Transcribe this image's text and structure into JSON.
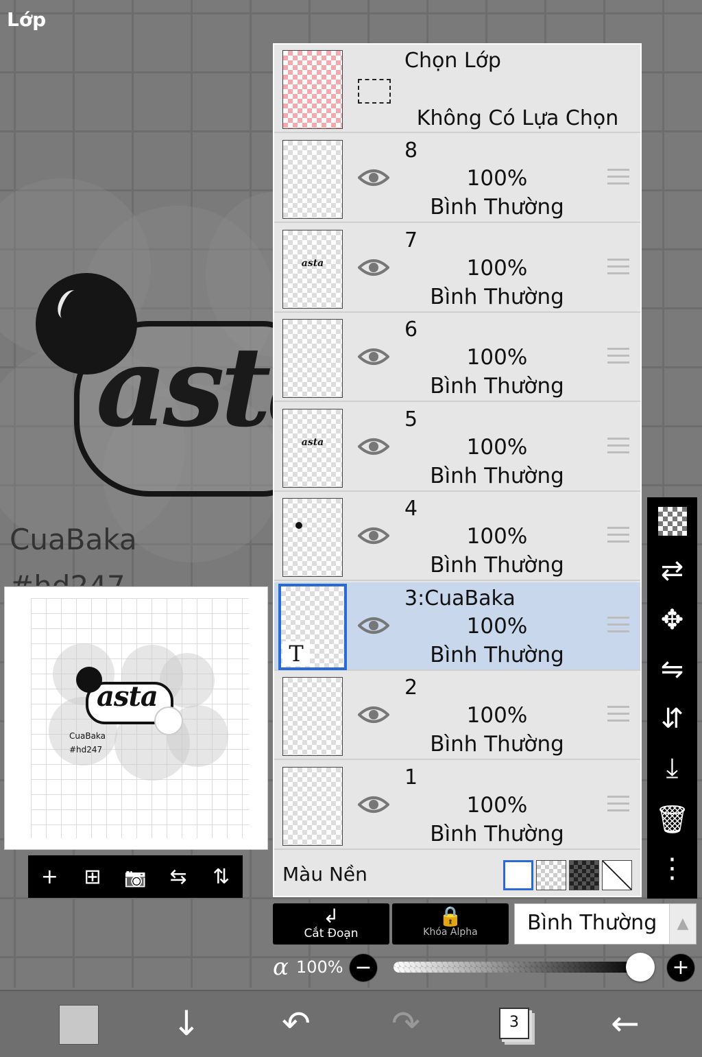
{
  "title": "Lớp",
  "canvas": {
    "art_text": "asta",
    "name": "CuaBaka",
    "tag_partial": "#hd247"
  },
  "preview": {
    "art_text": "asta",
    "name": "CuaBaka",
    "tag": "#hd247"
  },
  "preview_toolbar": [
    {
      "icon": "add-layer-icon",
      "glyph": "+"
    },
    {
      "icon": "new-layer-icon",
      "glyph": "⊞"
    },
    {
      "icon": "camera-icon",
      "glyph": "📷"
    },
    {
      "icon": "flip-horizontal-icon",
      "glyph": "⇆"
    },
    {
      "icon": "flip-vertical-icon",
      "glyph": "⇅"
    }
  ],
  "selection": {
    "title": "Chọn Lớp",
    "subtitle": "Không Có Lựa Chọn"
  },
  "layers": [
    {
      "name": "8",
      "opacity": "100%",
      "mode": "Bình Thường"
    },
    {
      "name": "7",
      "opacity": "100%",
      "mode": "Bình Thường",
      "thumb_text": "asta"
    },
    {
      "name": "6",
      "opacity": "100%",
      "mode": "Bình Thường"
    },
    {
      "name": "5",
      "opacity": "100%",
      "mode": "Bình Thường",
      "thumb_text": "asta"
    },
    {
      "name": "4",
      "opacity": "100%",
      "mode": "Bình Thường"
    },
    {
      "name": "3:CuaBaka",
      "opacity": "100%",
      "mode": "Bình Thường",
      "selected": true,
      "badge": "T"
    },
    {
      "name": "2",
      "opacity": "100%",
      "mode": "Bình Thường"
    },
    {
      "name": "1",
      "opacity": "100%",
      "mode": "Bình Thường"
    }
  ],
  "background": {
    "label": "Màu Nền",
    "options": [
      "white",
      "transparent",
      "dark-checker",
      "none"
    ],
    "selected": "white"
  },
  "right_tools": [
    "checker-icon",
    "transform-swap-icon",
    "move-icon",
    "flip-h-icon",
    "flip-v-icon",
    "merge-down-icon",
    "trash-icon",
    "more-icon"
  ],
  "buttons": {
    "clip": "Cắt Đoạn",
    "alpha_lock": "Khóa Alpha"
  },
  "blend_mode": "Bình Thường",
  "opacity": {
    "symbol": "α",
    "value": "100%",
    "level": 1.0
  },
  "bottom_bar": {
    "pages": "3"
  },
  "colors": {
    "selected_row": "#c9d7ec",
    "accent": "#2a6ad6",
    "panel": "#e6e6e6"
  }
}
